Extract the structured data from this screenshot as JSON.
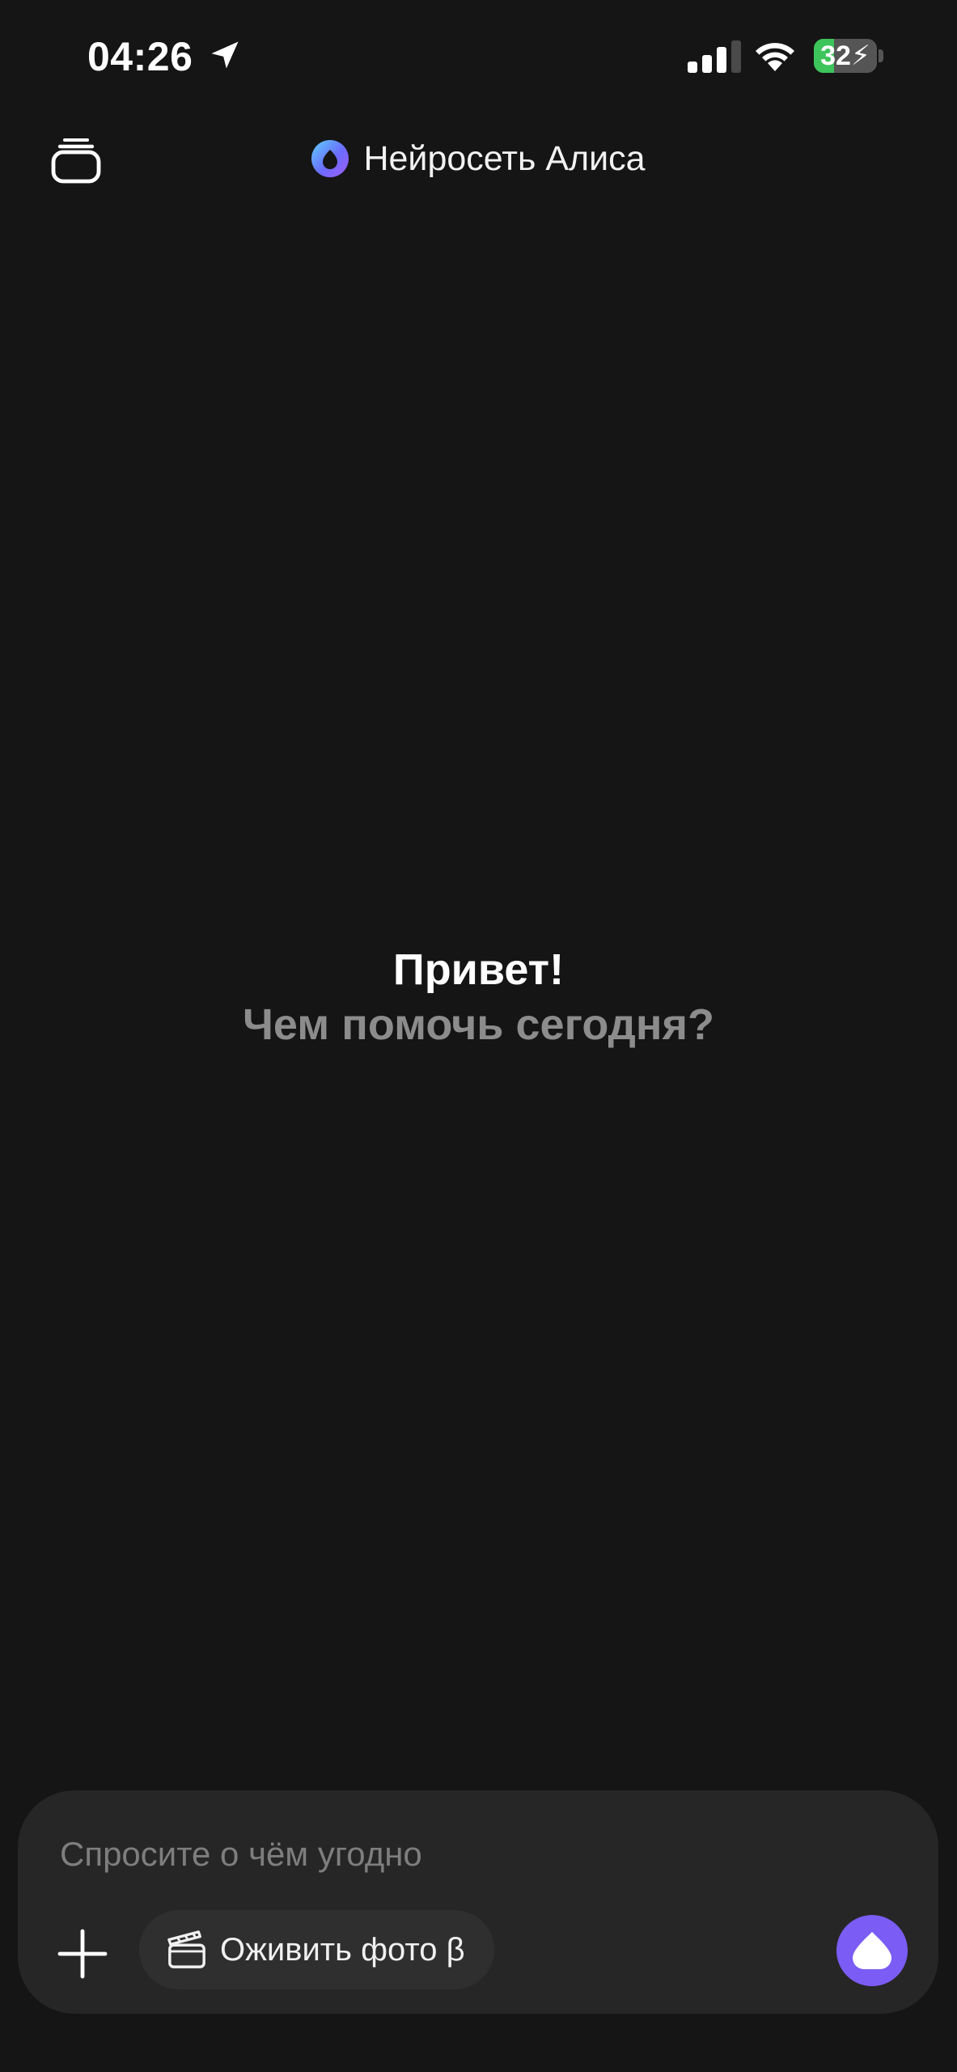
{
  "status_bar": {
    "time": "04:26",
    "battery_level": "32",
    "battery_fraction": 0.32,
    "battery_charging": true,
    "icons": [
      "location-arrow-icon",
      "cellular-signal-icon",
      "wifi-icon",
      "battery-icon"
    ]
  },
  "header": {
    "title": "Нейросеть Алиса",
    "history_icon": "stacked-cards-icon",
    "logo_icon": "alice-logo-icon"
  },
  "greeting": {
    "title": "Привет!",
    "subtitle": "Чем помочь сегодня?"
  },
  "composer": {
    "placeholder": "Спросите о чём угодно",
    "value": "",
    "add_icon": "plus-icon",
    "chip": {
      "label": "Оживить фото β",
      "icon": "clapperboard-icon"
    },
    "voice_icon": "alice-voice-icon"
  },
  "colors": {
    "background": "#151515",
    "composer_bg": "#262626",
    "chip_bg": "#2f2f2f",
    "accent": "#7b5cf5",
    "battery_green": "#3dc45a",
    "muted_text": "#8c8c8c"
  }
}
